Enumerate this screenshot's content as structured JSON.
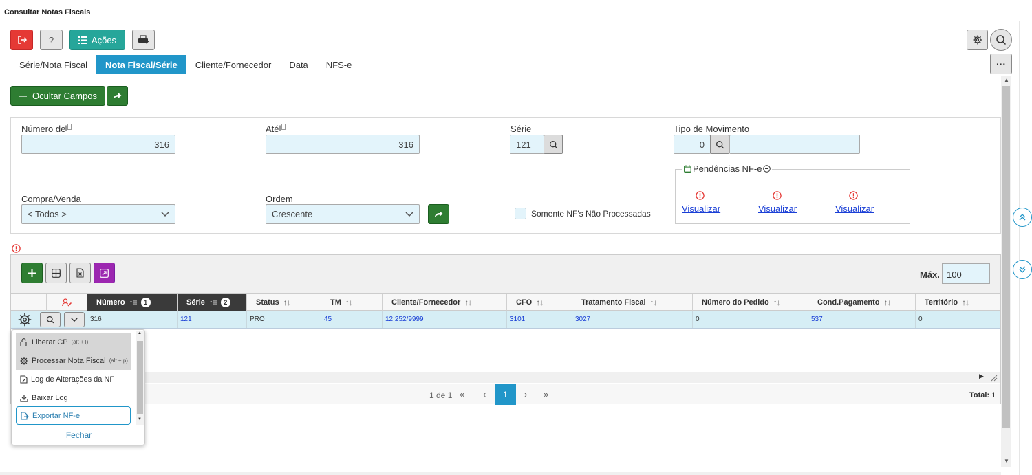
{
  "window": {
    "title": "Consultar Notas Fiscais"
  },
  "toolbar": {
    "acoes_label": "Ações"
  },
  "tabs": [
    {
      "label": "Série/Nota Fiscal"
    },
    {
      "label": "Nota Fiscal/Série"
    },
    {
      "label": "Cliente/Fornecedor"
    },
    {
      "label": "Data"
    },
    {
      "label": "NFS-e"
    }
  ],
  "more_label": "···",
  "ocultar_label": "Ocultar Campos",
  "filters": {
    "numero_de": {
      "label": "Número de",
      "value": "316"
    },
    "ate": {
      "label": "Até",
      "value": "316"
    },
    "serie": {
      "label": "Série",
      "value": "121"
    },
    "tipo_movimento": {
      "label": "Tipo de Movimento",
      "value": "0"
    },
    "compra_venda": {
      "label": "Compra/Venda",
      "value": "< Todos >"
    },
    "ordem": {
      "label": "Ordem",
      "value": "Crescente"
    },
    "somente_label": "Somente NF's Não Processadas",
    "pendencias": {
      "legend": "Pendências NF-e",
      "links": [
        "Visualizar",
        "Visualizar",
        "Visualizar"
      ]
    }
  },
  "grid": {
    "max_label": "Máx.",
    "max_value": "100",
    "columns": [
      {
        "label": "Número",
        "badge": "1"
      },
      {
        "label": "Série",
        "badge": "2"
      },
      {
        "label": "Status"
      },
      {
        "label": "TM"
      },
      {
        "label": "Cliente/Fornecedor"
      },
      {
        "label": "CFO"
      },
      {
        "label": "Tratamento Fiscal"
      },
      {
        "label": "Número do Pedido"
      },
      {
        "label": "Cond.Pagamento"
      },
      {
        "label": "Território"
      }
    ],
    "row": {
      "numero": "316",
      "serie": "121",
      "status": "PRO",
      "tm": "45",
      "cliente": "12.252/9999",
      "cfo": "3101",
      "tratamento": "3027",
      "pedido": "0",
      "cond_pagamento": "537",
      "territorio": "0"
    },
    "pager": {
      "page_info": "1 de 1",
      "current": "1",
      "total_label": "Total:",
      "total_value": "1"
    }
  },
  "menu": {
    "items": [
      {
        "label": "Liberar CP",
        "shortcut": "(alt + l)"
      },
      {
        "label": "Processar Nota Fiscal",
        "shortcut": "(alt + p)"
      },
      {
        "label": "Log de Alterações da NF",
        "shortcut": ""
      },
      {
        "label": "Baixar Log",
        "shortcut": ""
      },
      {
        "label": "Exportar NF-e",
        "shortcut": ""
      }
    ],
    "close_label": "Fechar"
  }
}
